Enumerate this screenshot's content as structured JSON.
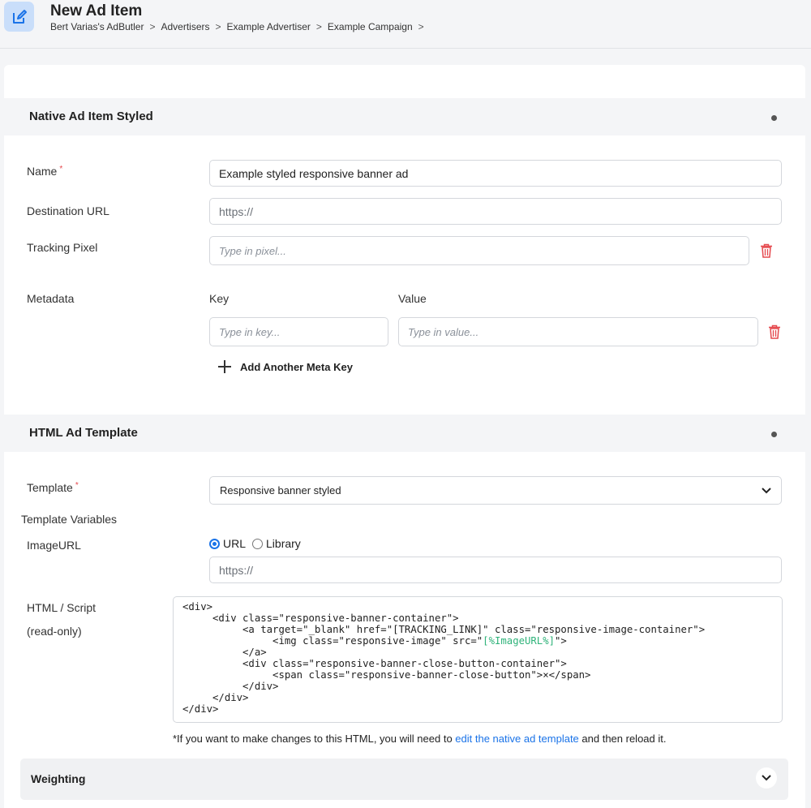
{
  "header": {
    "title": "New Ad Item",
    "breadcrumb": [
      "Bert Varias's AdButler",
      "Advertisers",
      "Example Advertiser",
      "Example Campaign"
    ],
    "separator": ">",
    "icon": "edit-icon",
    "icon_color": "#1a73e8"
  },
  "native_section": {
    "title": "Native Ad Item Styled",
    "name_label": "Name",
    "required_mark": "*",
    "name_value": "Example styled responsive banner ad",
    "destination_label": "Destination URL",
    "destination_placeholder": "https://",
    "tracking_label": "Tracking Pixel",
    "tracking_placeholder": "Type in pixel...",
    "metadata_label": "Metadata",
    "key_header": "Key",
    "value_header": "Value",
    "key_placeholder": "Type in key...",
    "value_placeholder": "Type in value...",
    "add_meta_label": "Add Another Meta Key"
  },
  "template_section": {
    "title": "HTML Ad Template",
    "template_label": "Template",
    "required_mark": "*",
    "template_value": "Responsive banner styled",
    "variables_label": "Template Variables",
    "imageurl_label": "ImageURL",
    "radio_url": "URL",
    "radio_library": "Library",
    "selected_radio": "URL",
    "imageurl_placeholder": "https://",
    "html_label": "HTML / Script",
    "readonly_label": "(read-only)",
    "code_lines": [
      "<div>",
      "     <div class=\"responsive-banner-container\">",
      "          <a target=\"_blank\" href=\"[TRACKING_LINK]\" class=\"responsive-image-container\">",
      "               <img class=\"responsive-image\" src=\"",
      "          </a>",
      "          <div class=\"responsive-banner-close-button-container\">",
      "               <span class=\"responsive-banner-close-button\">×</span>",
      "          </div>",
      "     </div>",
      "</div>"
    ],
    "code_variable": "[%ImageURL%]",
    "code_after_variable": "\">",
    "note_prefix": "*If you want to make changes to this HTML, you will need to ",
    "note_link": "edit the native ad template",
    "note_suffix": " and then reload it."
  },
  "weighting": {
    "title": "Weighting"
  },
  "colors": {
    "accent": "#1a73e8",
    "danger": "#e5484d",
    "code_variable": "#2fb37a"
  }
}
